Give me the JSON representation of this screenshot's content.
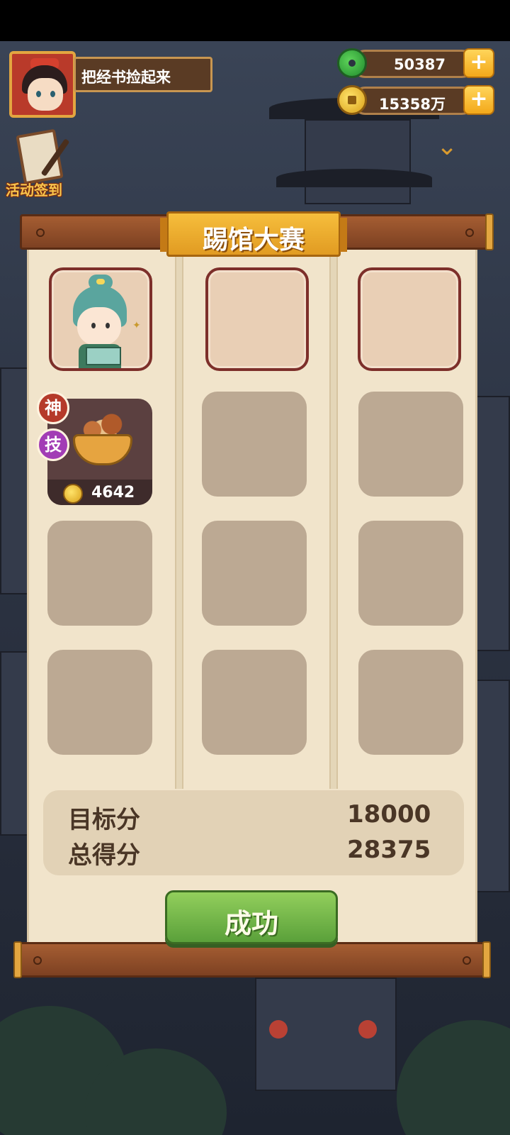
{
  "hud": {
    "quest_text": "把经书捡起来",
    "jade_amount": "50387",
    "coin_amount": "15358万",
    "plus_symbol": "+",
    "dropdown_icon": "chevron-down-icon",
    "signin_label": "活动签到"
  },
  "panel": {
    "title": "踢馆大赛",
    "team_slots": [
      "hero-filled",
      "empty",
      "empty"
    ],
    "dish": {
      "god_badge": "神",
      "skill_badge": "技",
      "price": "4642"
    },
    "score": {
      "target_label": "目标分",
      "target_value": "18000",
      "total_label": "总得分",
      "total_value": "28375"
    },
    "result_button": "成功"
  },
  "colors": {
    "panel_bg": "#f1e4cb",
    "slot_empty": "#bca993",
    "button_green": "#5aa03a",
    "banner_gold": "#e19b22"
  }
}
